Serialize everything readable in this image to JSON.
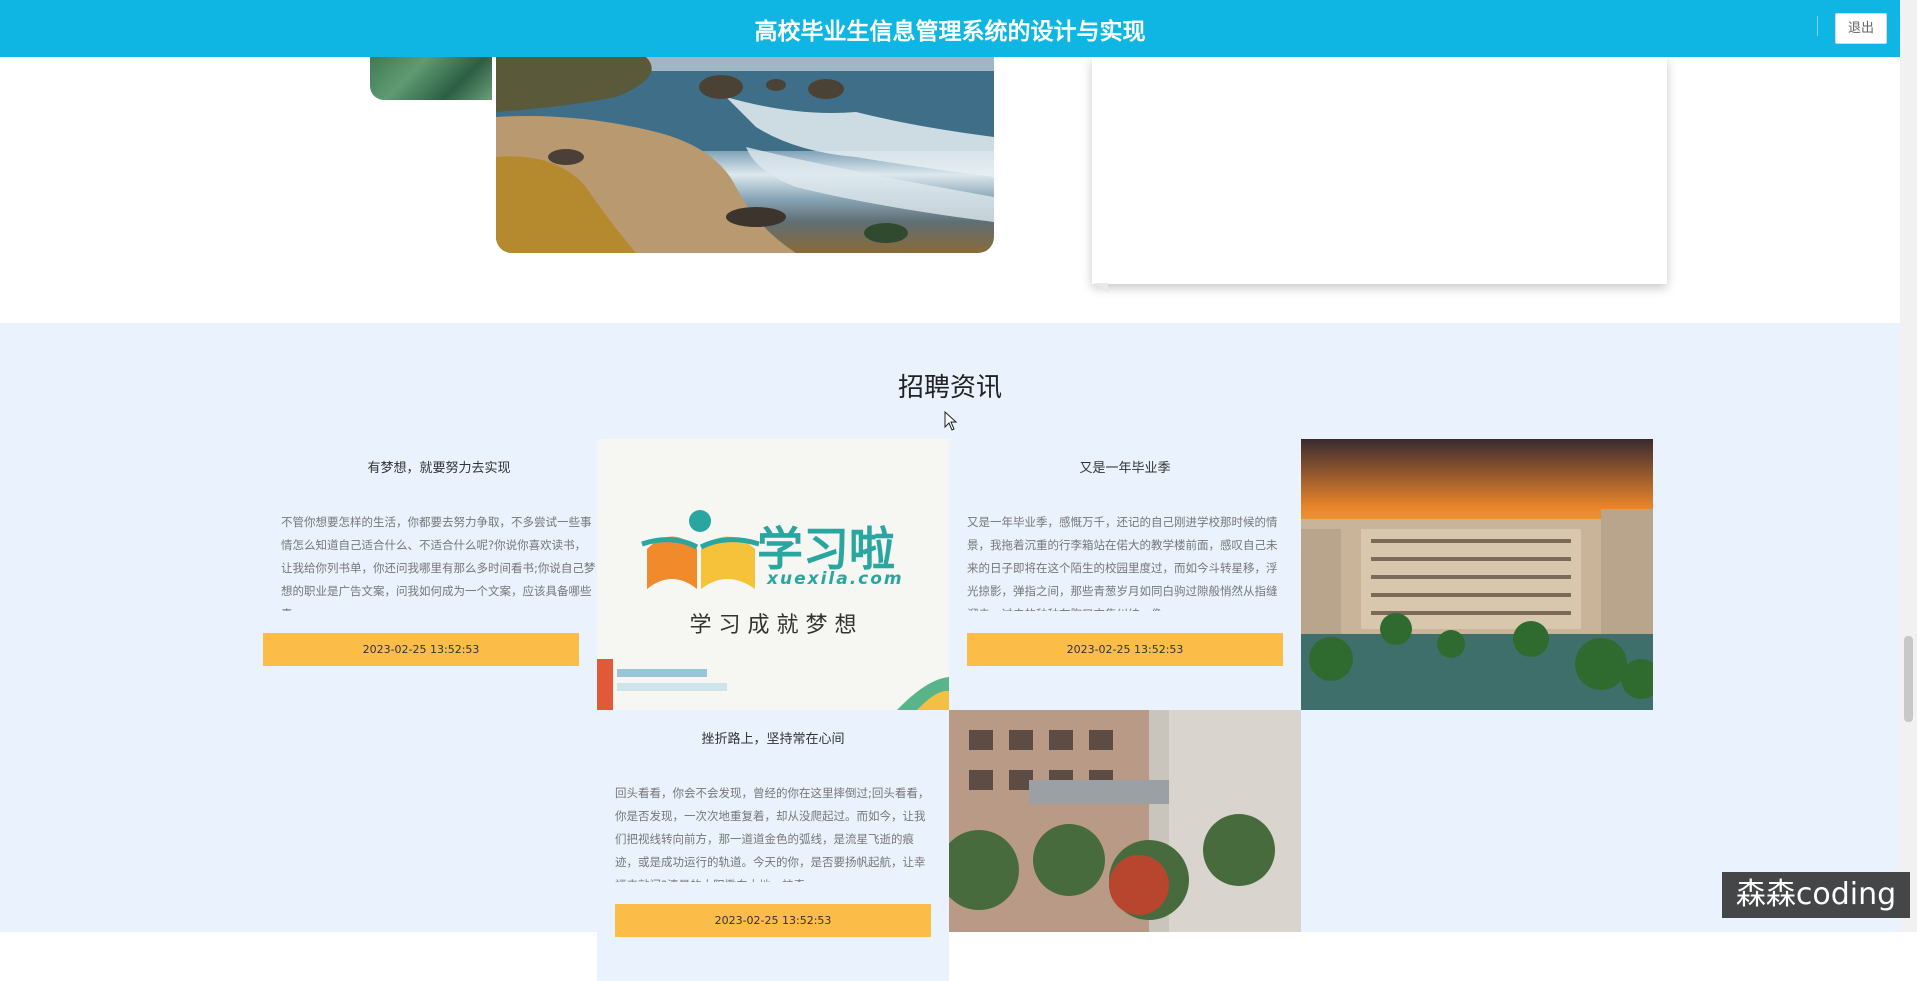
{
  "header": {
    "title": "高校毕业生信息管理系统的设计与实现",
    "logout_label": "退出"
  },
  "section": {
    "title": "招聘资讯"
  },
  "news": [
    {
      "title": "有梦想，就要努力去实现",
      "body": "不管你想要怎样的生活，你都要去努力争取，不多尝试一些事情怎么知道自己适合什么、不适合什么呢?你说你喜欢读书，让我给你列书单，你还问我哪里有那么多时间看书;你说自己梦想的职业是广告文案，问我如何成为一个文案，应该具备哪些素",
      "date": "2023-02-25 13:52:53"
    },
    {
      "title": "又是一年毕业季",
      "body": "又是一年毕业季，感慨万千，还记的自己刚进学校那时候的情景，我拖着沉重的行李箱站在偌大的教学楼前面，感叹自己未来的日子即将在这个陌生的校园里度过，而如今斗转星移，浮光掠影，弹指之间，那些青葱岁月如同白驹过隙般悄然从指缝溜走。过去的种种在胸口交集纠结，像",
      "date": "2023-02-25 13:52:53"
    },
    {
      "title": "挫折路上，坚持常在心间",
      "body": "回头看看，你会不会发现，曾经的你在这里摔倒过;回头看看，你是否发现，一次次地重复着，却从没爬起过。而如今，让我们把视线转向前方，那一道道金色的弧线，是流星飞逝的痕迹，或是成功运行的轨道。今天的你，是否要扬帆起航，让幸福来敲门?清晨的太阳撒向大地，神奇",
      "date": "2023-02-25 13:52:53"
    }
  ],
  "logo_tile": {
    "brand_cn": "学习啦",
    "brand_en": "xuexila.com",
    "slogan": "学 习 成 就 梦 想"
  },
  "watermark": "森森coding",
  "colors": {
    "header": "#0fb6e4",
    "section_bg": "#e9f2fd",
    "date_bar": "#fbbd48"
  }
}
